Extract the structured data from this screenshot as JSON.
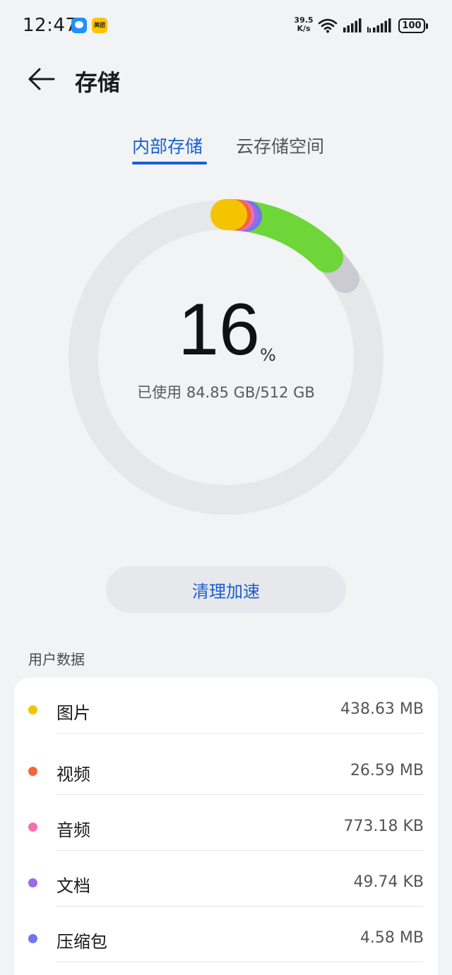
{
  "status_bar": {
    "time": "12:47",
    "net_speed_value": "39.5",
    "net_speed_unit": "K/s",
    "battery": "100",
    "meituan_label": "美团"
  },
  "header": {
    "title": "存储"
  },
  "tabs": [
    {
      "label": "内部存储",
      "active": true
    },
    {
      "label": "云存储空间",
      "active": false
    }
  ],
  "usage": {
    "percent": "16",
    "unit": "%",
    "text": "已使用 84.85 GB/512 GB"
  },
  "clean_button": {
    "label": "清理加速"
  },
  "user_data": {
    "title": "用户数据",
    "items": [
      {
        "name": "图片",
        "size": "438.63 MB",
        "color": "#f5c400"
      },
      {
        "name": "视频",
        "size": "26.59 MB",
        "color": "#f4663a"
      },
      {
        "name": "音频",
        "size": "773.18 KB",
        "color": "#f46fb0"
      },
      {
        "name": "文档",
        "size": "49.74 KB",
        "color": "#9b6be6"
      },
      {
        "name": "压缩包",
        "size": "4.58 MB",
        "color": "#6f76ee"
      }
    ]
  },
  "colors": {
    "accent": "#1a5fd1",
    "ring_track": "#e6e7e9",
    "apps_green": "#6fd63a",
    "other_grey": "#c7c6cf"
  }
}
